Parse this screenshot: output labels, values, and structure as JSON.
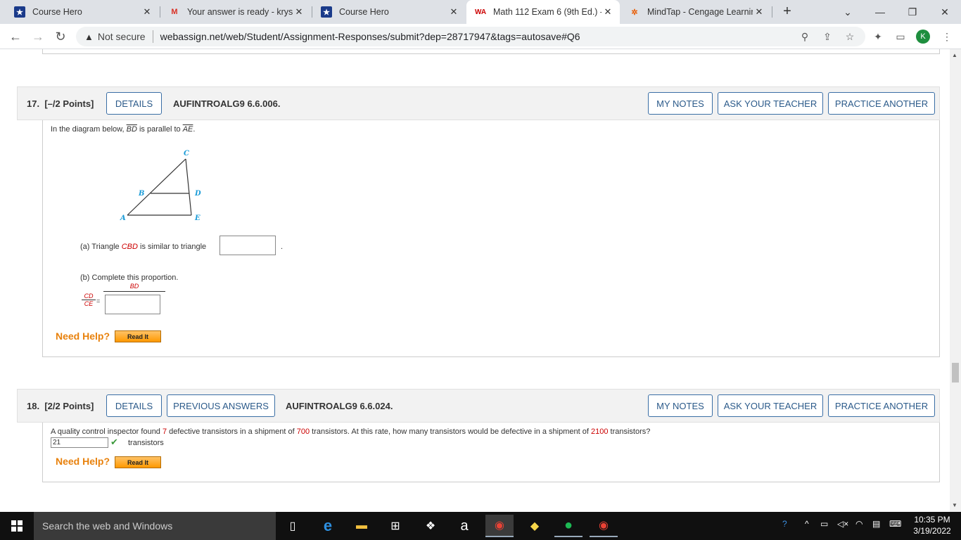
{
  "browser": {
    "tabs": [
      {
        "title": "Course Hero",
        "icon": "star-icon"
      },
      {
        "title": "Your answer is ready - krystal",
        "icon": "gmail-icon"
      },
      {
        "title": "Course Hero",
        "icon": "star-icon"
      },
      {
        "title": "Math 112 Exam 6 (9th Ed.) - ",
        "icon": "webassign-icon",
        "active": true
      },
      {
        "title": "MindTap - Cengage Learning",
        "icon": "mindtap-icon"
      }
    ],
    "address": {
      "security": "Not secure",
      "url": "webassign.net/web/Student/Assignment-Responses/submit?dep=28717947&tags=autosave#Q6"
    },
    "profile_initial": "K"
  },
  "q17": {
    "number": "17.",
    "points": "[–/2 Points]",
    "details": "DETAILS",
    "code": "AUFINTROALG9 6.6.006.",
    "my_notes": "MY NOTES",
    "ask_teacher": "ASK YOUR TEACHER",
    "practice": "PRACTICE ANOTHER",
    "intro_pre": "In the diagram below, ",
    "seg1": "BD",
    "intro_mid": " is parallel to ",
    "seg2": "AE",
    "intro_end": ".",
    "diagram": {
      "A": "A",
      "B": "B",
      "C": "C",
      "D": "D",
      "E": "E"
    },
    "part_a_pre": "(a) Triangle ",
    "part_a_tri": "CBD",
    "part_a_post": " is similar to triangle",
    "part_a_value": "",
    "part_a_period": ".",
    "part_b": "(b) Complete this proportion.",
    "frac_num": "CD",
    "frac_den": "CE",
    "equals": "=",
    "rhs_num": "BD",
    "rhs_den_value": "",
    "need_help": "Need Help?",
    "read_it": "Read It"
  },
  "q18": {
    "number": "18.",
    "points": "[2/2 Points]",
    "details": "DETAILS",
    "previous": "PREVIOUS ANSWERS",
    "code": "AUFINTROALG9 6.6.024.",
    "my_notes": "MY NOTES",
    "ask_teacher": "ASK YOUR TEACHER",
    "practice": "PRACTICE ANOTHER",
    "text_1": "A quality control inspector found ",
    "n1": "7",
    "text_2": " defective transistors in a shipment of ",
    "n2": "700",
    "text_3": " transistors. At this rate, how many transistors would be defective in a shipment of ",
    "n3": "2100",
    "text_4": " transistors?",
    "answer": "21",
    "unit": "transistors",
    "need_help": "Need Help?",
    "read_it": "Read It"
  },
  "taskbar": {
    "search_placeholder": "Search the web and Windows",
    "time": "10:35 PM",
    "date": "3/19/2022"
  }
}
